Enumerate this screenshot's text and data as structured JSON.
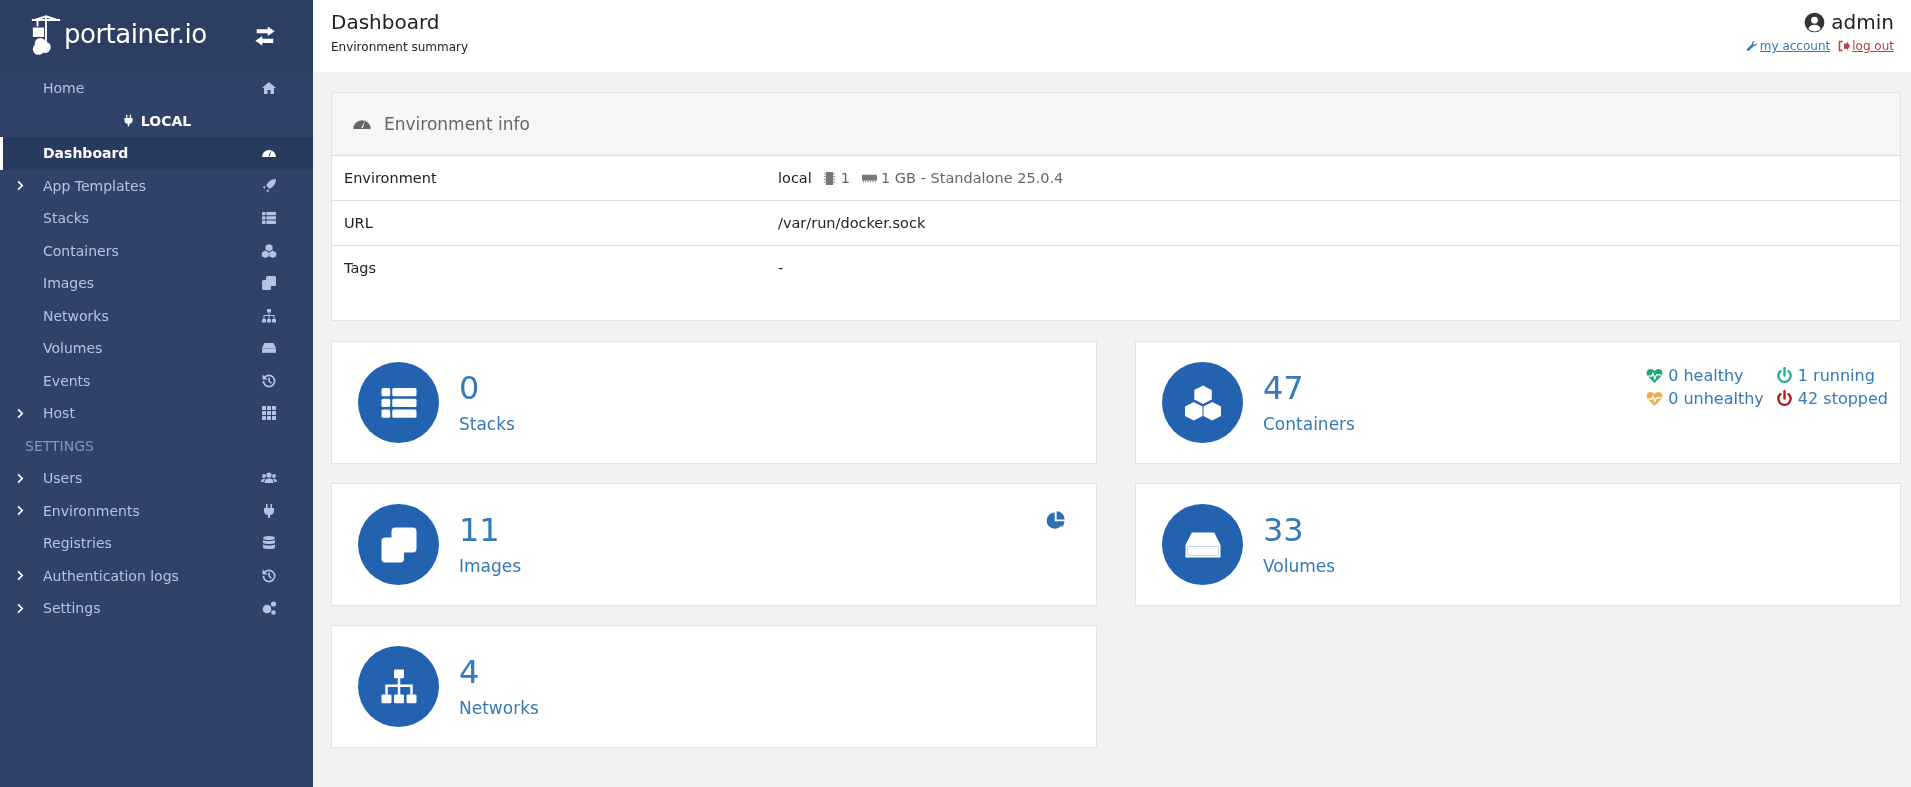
{
  "brand": {
    "name": "portainer.io"
  },
  "sidebar": {
    "entries": [
      {
        "kind": "link",
        "label": "Home",
        "selected": false,
        "expandable": false
      },
      {
        "kind": "environment",
        "label": "LOCAL"
      },
      {
        "kind": "link",
        "label": "Dashboard",
        "selected": true,
        "expandable": false
      },
      {
        "kind": "link",
        "label": "App Templates",
        "selected": false,
        "expandable": true
      },
      {
        "kind": "link",
        "label": "Stacks",
        "selected": false,
        "expandable": false
      },
      {
        "kind": "link",
        "label": "Containers",
        "selected": false,
        "expandable": false
      },
      {
        "kind": "link",
        "label": "Images",
        "selected": false,
        "expandable": false
      },
      {
        "kind": "link",
        "label": "Networks",
        "selected": false,
        "expandable": false
      },
      {
        "kind": "link",
        "label": "Volumes",
        "selected": false,
        "expandable": false
      },
      {
        "kind": "link",
        "label": "Events",
        "selected": false,
        "expandable": false
      },
      {
        "kind": "link",
        "label": "Host",
        "selected": false,
        "expandable": true
      },
      {
        "kind": "section",
        "label": "SETTINGS"
      },
      {
        "kind": "link",
        "label": "Users",
        "selected": false,
        "expandable": true
      },
      {
        "kind": "link",
        "label": "Environments",
        "selected": false,
        "expandable": true
      },
      {
        "kind": "link",
        "label": "Registries",
        "selected": false,
        "expandable": false
      },
      {
        "kind": "link",
        "label": "Authentication logs",
        "selected": false,
        "expandable": true
      },
      {
        "kind": "link",
        "label": "Settings",
        "selected": false,
        "expandable": true
      }
    ]
  },
  "header": {
    "title": "Dashboard",
    "subtitle": "Environment summary",
    "user": "admin",
    "links": [
      {
        "kind": "account",
        "label": "my account"
      },
      {
        "kind": "logout",
        "label": "log out"
      }
    ]
  },
  "environment_info": {
    "title": "Environment info",
    "rows": [
      {
        "kind": "environment",
        "label": "Environment",
        "name": "local",
        "cpu": "1",
        "memory": "1 GB - Standalone 25.0.4"
      },
      {
        "kind": "text",
        "label": "URL",
        "value": "/var/run/docker.sock"
      },
      {
        "kind": "text",
        "label": "Tags",
        "value": "-"
      }
    ]
  },
  "cards": [
    {
      "kind": "stacks",
      "count": "0",
      "label": "Stacks"
    },
    {
      "kind": "containers",
      "count": "47",
      "label": "Containers",
      "status": [
        {
          "kind": "heart",
          "label": "0 healthy",
          "color": "#23a47a"
        },
        {
          "kind": "power",
          "label": "1 running",
          "color": "#23ae89"
        },
        {
          "kind": "heart",
          "label": "0 unhealthy",
          "color": "#f0ad4e"
        },
        {
          "kind": "power",
          "label": "42 stopped",
          "color": "#ae1a1a"
        }
      ]
    },
    {
      "kind": "images",
      "count": "11",
      "label": "Images"
    },
    {
      "kind": "volumes",
      "count": "33",
      "label": "Volumes"
    },
    {
      "kind": "networks",
      "count": "4",
      "label": "Networks"
    }
  ]
}
